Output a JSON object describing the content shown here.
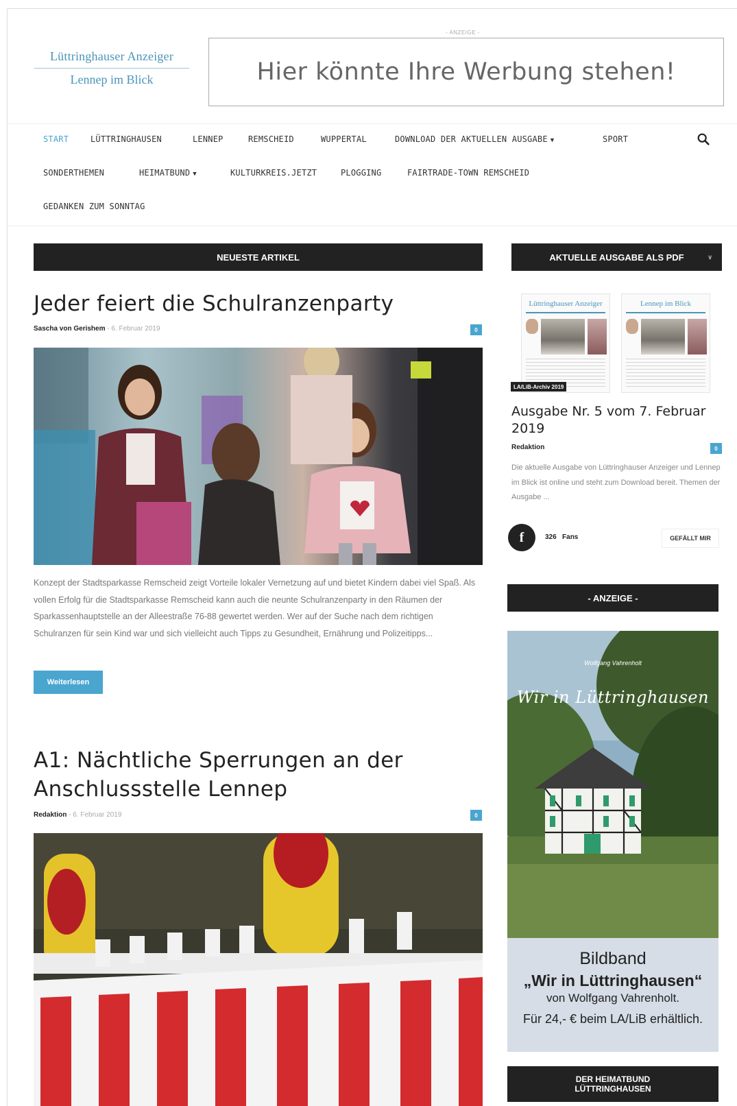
{
  "header": {
    "logo_line1": "Lüttringhauser Anzeiger",
    "logo_line2": "Lennep im Blick",
    "ad_label": "- ANZEIGE -",
    "banner_text": "Hier könnte Ihre Werbung stehen!"
  },
  "nav": {
    "items": [
      {
        "label": "START",
        "active": true
      },
      {
        "label": "LÜTTRINGHAUSEN"
      },
      {
        "label": "LENNEP"
      },
      {
        "label": "REMSCHEID"
      },
      {
        "label": "WUPPERTAL"
      },
      {
        "label": "DOWNLOAD DER AKTUELLEN AUSGABE",
        "has_dropdown": true
      },
      {
        "label": "SPORT"
      },
      {
        "label": "SONDERTHEMEN"
      },
      {
        "label": "HEIMATBUND",
        "has_dropdown": true
      },
      {
        "label": "KULTURKREIS.JETZT"
      },
      {
        "label": "PLOGGING"
      },
      {
        "label": "FAIRTRADE-TOWN REMSCHEID"
      },
      {
        "label": "GEDANKEN ZUM SONNTAG"
      }
    ],
    "search_icon": "search-icon",
    "accent_color": "#4aa5cf"
  },
  "main": {
    "section_title": "NEUESTE ARTIKEL",
    "articles": [
      {
        "title": "Jeder feiert die Schulranzenparty",
        "author": "Sascha von Gerishem",
        "date": "6. Februar 2019",
        "comments": "0",
        "excerpt": "Konzept der Stadtsparkasse Remscheid zeigt Vorteile lokaler Vernetzung auf und bietet Kindern dabei viel Spaß. Als vollen Erfolg für die Stadtsparkasse Remscheid kann auch die neunte Schulranzenparty in den Räumen der Sparkassenhauptstelle an der Alleestraße 76-88 gewertet werden. Wer auf der Suche nach dem richtigen Schulranzen für sein Kind war und sich vielleicht auch Tipps zu Gesundheit, Ernährung und Polizeitipps...",
        "read_more": "Weiterlesen"
      },
      {
        "title": "A1: Nächtliche Sperrungen an der Anschlussstelle Lennep",
        "author": "Redaktion",
        "date": "6. Februar 2019",
        "comments": "0"
      }
    ]
  },
  "sidebar": {
    "pdf_section_title": "AKTUELLE AUSGABE ALS PDF",
    "thumb_left_title": "Lüttringhauser Anzeiger",
    "thumb_right_title": "Lennep im Blick",
    "archive_tag": "LA/LiB-Archiv 2019",
    "issue_title": "Ausgabe Nr. 5 vom 7. Februar 2019",
    "issue_author": "Redaktion",
    "issue_comments": "0",
    "issue_excerpt": "Die aktuelle Ausgabe von Lüttringhauser Anzeiger und Lennep im Blick ist online und steht zum Download bereit. Themen der Ausgabe ...",
    "facebook": {
      "icon": "f",
      "fans_count": "326",
      "fans_label": "Fans",
      "like_button": "GEFÄLLT MIR"
    },
    "ad_title": "- ANZEIGE -",
    "ad": {
      "author_small": "Wolfgang Vahrenholt",
      "cover_title": "Wir in Lüttringhausen",
      "line1": "Bildband",
      "line2": "„Wir in Lüttringhausen“",
      "line3": "von Wolfgang Vahrenholt.",
      "line4": "Für 24,- € beim LA/LiB erhältlich."
    },
    "heimatbund_line1": "DER HEIMATBUND",
    "heimatbund_line2": "LÜTTRINGHAUSEN"
  }
}
